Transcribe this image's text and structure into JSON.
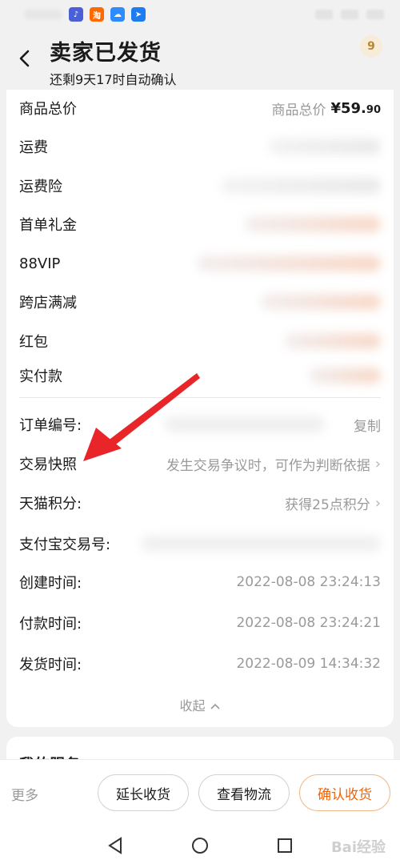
{
  "header": {
    "title": "卖家已发货",
    "subtitle": "还剩9天17时自动确认",
    "badge": "9"
  },
  "price_rows": [
    {
      "label": "商品总价",
      "value_label": "商品总价",
      "value": "¥59.",
      "value_decimal": "90"
    },
    {
      "label": "运费"
    },
    {
      "label": "运费险"
    },
    {
      "label": "首单礼金"
    },
    {
      "label": "88VIP"
    },
    {
      "label": "跨店满减"
    },
    {
      "label": "红包"
    },
    {
      "label": "实付款"
    }
  ],
  "info_rows": [
    {
      "label": "订单编号:",
      "action": "复制"
    },
    {
      "label": "交易快照",
      "value": "发生交易争议时，可作为判断依据"
    },
    {
      "label": "天猫积分:",
      "value": "获得25点积分"
    },
    {
      "label": "支付宝交易号:"
    },
    {
      "label": "创建时间:",
      "value": "2022-08-08 23:24:13"
    },
    {
      "label": "付款时间:",
      "value": "2022-08-08 23:24:21"
    },
    {
      "label": "发货时间:",
      "value": "2022-08-09 14:34:32"
    }
  ],
  "collapse_label": "收起",
  "services_title": "我的服务",
  "bottom": {
    "more": "更多",
    "extend": "延长收货",
    "logistics": "查看物流",
    "confirm": "确认收货"
  },
  "watermark": "Bai经验",
  "colors": {
    "accent": "#f0640a",
    "arrow": "#e8262a",
    "badge_bg": "#f6ecd8"
  },
  "status_icons": [
    "music-app-icon",
    "taobao-app-icon",
    "cloud-app-icon",
    "dingtalk-app-icon"
  ]
}
